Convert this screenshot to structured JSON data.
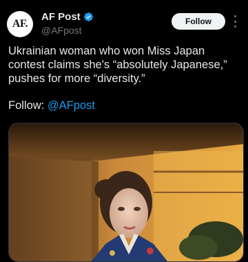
{
  "post": {
    "display_name": "AF Post",
    "handle": "@AFpost",
    "avatar_text": "AF.",
    "follow_label": "Follow",
    "text": "Ukrainian woman who won Miss Japan contest claims she's “absolutely Japanese,” pushes for more “diversity.”",
    "follow_prefix": "Follow: ",
    "follow_link": "@AFpost"
  },
  "colors": {
    "background": "#000000",
    "text": "#e7e9ea",
    "muted": "#71767b",
    "link": "#1d9bf0",
    "verified": "#1d9bf0",
    "button_bg": "#eff3f4"
  },
  "icons": {
    "verified": "verified-badge-icon",
    "more": "more-options-icon"
  }
}
